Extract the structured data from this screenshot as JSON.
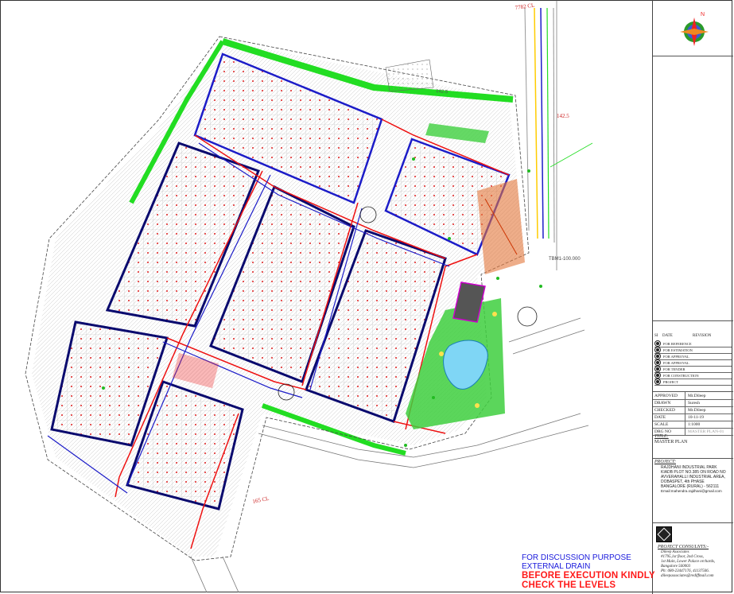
{
  "colors": {
    "boundary_green": "#22dd22",
    "road_blue": "#1c1cc8",
    "road_navy": "#0a0a6e",
    "drain_red": "#ee1111",
    "grid_line": "#b8b8b8",
    "water": "#7fd6f5",
    "garden": "#3ecf3e",
    "note_blue": "#1a1adc",
    "note_red": "#ff1a1a"
  },
  "compass": {
    "icon": "north-arrow-compass-icon",
    "label": "N"
  },
  "plan_labels": {
    "road_chainage": "7782 CL",
    "level_top": "142.5",
    "tbm": "TBM1-100.000",
    "level_bottom_right": "142.5",
    "level_bottom": "165 CL"
  },
  "revision": {
    "headers": [
      "SI",
      "DATE",
      "REVISION"
    ],
    "rows": [
      "FOR REFERENCE",
      "FOR ESTIMATION",
      "FOR APPROVAL",
      "FOR APPROVAL",
      "FOR TENDER",
      "FOR CONSTRUCTION",
      "PROJECT"
    ]
  },
  "details": [
    {
      "key": "APPROVED",
      "value": "Mr.Dileep"
    },
    {
      "key": "DRAWN",
      "value": "Suresh"
    },
    {
      "key": "CHECKED",
      "value": "Mr.Dileep"
    },
    {
      "key": "DATE",
      "value": "10-11-19"
    },
    {
      "key": "SCALE",
      "value": "1:1000"
    },
    {
      "key": "DRG NO",
      "value": "MASTER PLAN-01"
    }
  ],
  "title": {
    "label": "TITLE:",
    "value": "MASTER PLAN"
  },
  "project": {
    "label": "PROJECT:",
    "lines": [
      "RAJDHANI INDUSTRIAL PARK",
      "KIADB PLOT NO.385 ON ROAD NO",
      "AVVERAHALLI INDUSTRIAL AREA,",
      "DOBASPET, 4th PHASE",
      "BANGALORE (RURAL) - 562111",
      "Email:mahendra.rajdhani@gmail.com"
    ]
  },
  "consultants": {
    "label": "PROJECT CONSULNTS:-",
    "lines": [
      "Dileep Associates",
      "#1795,1st floor, 2nd Cross,",
      "1st Main, Lower Palace orchards,",
      "Bangalore 560003",
      "Ph: 080-23447176, 41137506.",
      "dileepassociates@rediffmail.com"
    ]
  },
  "notes": {
    "line1": "FOR DISCUSSION PURPOSE",
    "line2": "EXTERNAL DRAIN",
    "line3": "BEFORE EXECUTION KINDLY",
    "line4": "CHECK THE LEVELS"
  }
}
